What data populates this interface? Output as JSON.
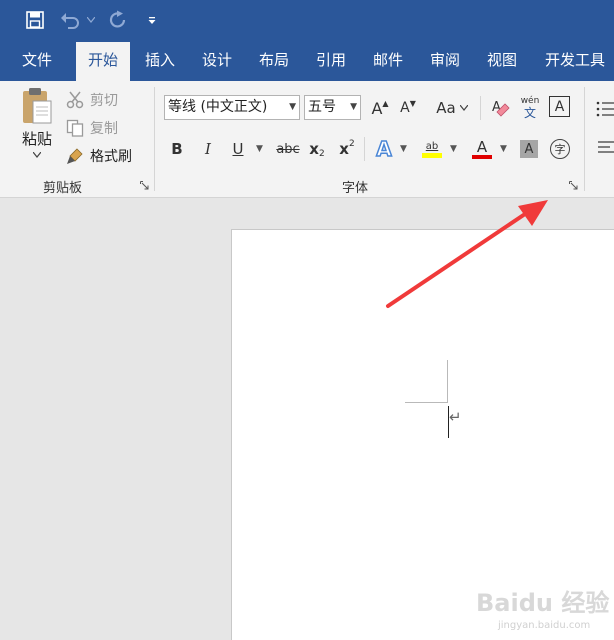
{
  "quick_access": {
    "save_icon": "save-icon",
    "undo_icon": "undo-icon",
    "redo_icon": "redo-icon",
    "customize_icon": "customize-qat-icon"
  },
  "tabs": [
    {
      "label": "文件"
    },
    {
      "label": "开始"
    },
    {
      "label": "插入"
    },
    {
      "label": "设计"
    },
    {
      "label": "布局"
    },
    {
      "label": "引用"
    },
    {
      "label": "邮件"
    },
    {
      "label": "审阅"
    },
    {
      "label": "视图"
    },
    {
      "label": "开发工具"
    }
  ],
  "active_tab": "开始",
  "clipboard": {
    "paste_label": "粘贴",
    "cut_label": "剪切",
    "copy_label": "复制",
    "format_painter_label": "格式刷",
    "group_label": "剪贴板"
  },
  "font": {
    "font_name": "等线 (中文正文)",
    "font_size": "五号",
    "grow_label": "A",
    "shrink_label": "A",
    "change_case_label": "Aa",
    "phonetic_top": "wén",
    "phonetic_bottom": "文",
    "border_label": "A",
    "bold_label": "B",
    "italic_label": "I",
    "underline_label": "U",
    "strike_label": "abc",
    "subscript_label": "x",
    "subscript_sub": "2",
    "superscript_label": "x",
    "superscript_sup": "2",
    "effects_label": "A",
    "highlight_label": "ab",
    "font_color_label": "A",
    "shading_label": "A",
    "enclose_label": "字",
    "group_label": "字体"
  },
  "document": {
    "paragraph_mark": "↵"
  },
  "watermark": {
    "brand": "Baidu 经验",
    "url": "jingyan.baidu.com"
  },
  "colors": {
    "brand_blue": "#2b579a",
    "highlight_yellow": "#ffff00",
    "font_color_red": "#e00000",
    "arrow_red": "#f03a3a"
  }
}
